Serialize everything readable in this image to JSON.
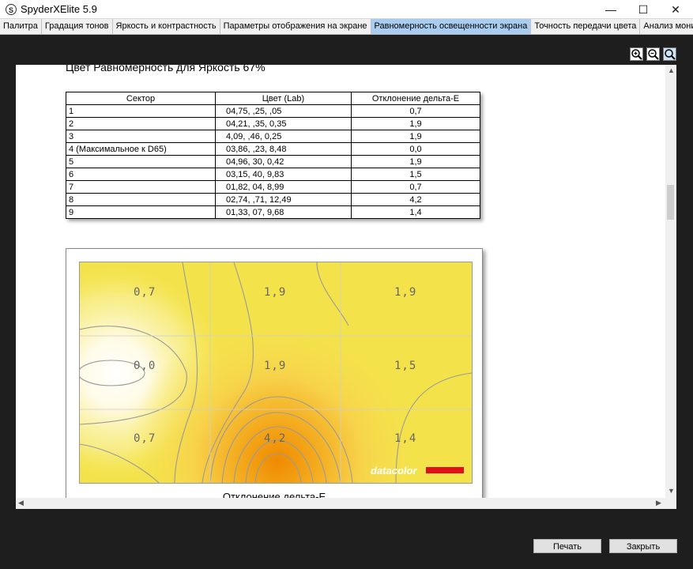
{
  "window": {
    "title": "SpyderXElite 5.9",
    "app_icon": "S",
    "minimize": "—",
    "maximize": "☐",
    "close": "✕"
  },
  "tabs": [
    {
      "label": "Палитра"
    },
    {
      "label": "Градация тонов"
    },
    {
      "label": "Яркость и контрастность"
    },
    {
      "label": "Параметры отображения на экране"
    },
    {
      "label": "Равномерность освещенности экрана",
      "active": true
    },
    {
      "label": "Точность передачи цвета"
    },
    {
      "label": "Анализ монитора"
    }
  ],
  "report": {
    "section_title": "Цвет Равномерность для Яркость 67%",
    "table": {
      "headers": [
        "Сектор",
        "Цвет (Lab)",
        "Отклонение дельта-E"
      ],
      "rows": [
        [
          "1",
          "04,75,    ,25,    ,05",
          "0,7"
        ],
        [
          "2",
          "04,21,    ,35,   0,35",
          "1,9"
        ],
        [
          "3",
          "4,09,    ,46,   0,25",
          "1,9"
        ],
        [
          "4 (Максимальное к D65)",
          "03,86,    ,23,   8,48",
          "0,0"
        ],
        [
          "5",
          "04,96,    30,   0,42",
          "1,9"
        ],
        [
          "6",
          "03,15,    40,   9,83",
          "1,5"
        ],
        [
          "7",
          "01,82,    04,   8,99",
          "0,7"
        ],
        [
          "8",
          "02,74,    ,71,  12,49",
          "4,2"
        ],
        [
          "9",
          "01,33,    07,   9,68",
          "1,4"
        ]
      ]
    },
    "uniformity_map": {
      "cell_values": [
        "0,7",
        "1,9",
        "1,9",
        "0,0",
        "1,9",
        "1,5",
        "0,7",
        "4,2",
        "1,4"
      ],
      "logo_text": "datacolor",
      "caption": "Отклонение дельта-E"
    }
  },
  "buttons": {
    "print": "Печать",
    "close": "Закрыть"
  },
  "icons": {
    "zoom_in": "zoom-in-icon",
    "zoom_out": "zoom-out-icon",
    "zoom_fit": "zoom-fit-icon"
  }
}
